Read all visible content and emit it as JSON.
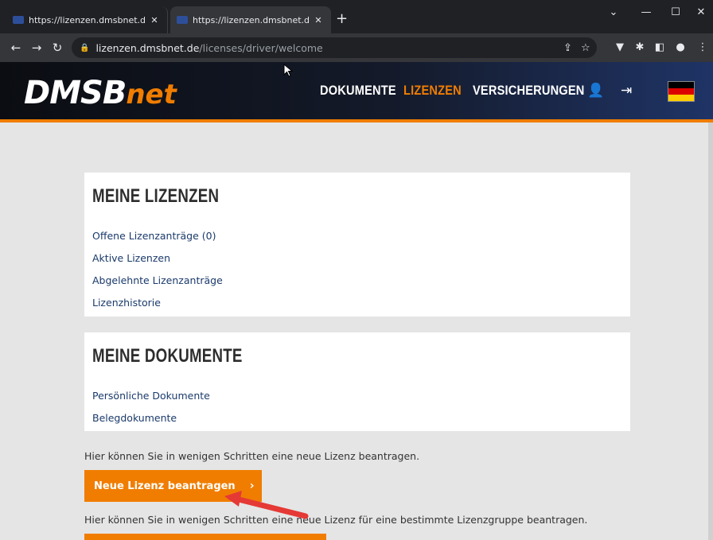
{
  "browser": {
    "tabs": [
      {
        "title": "https://lizenzen.dmsbnet.de/licen",
        "active": false
      },
      {
        "title": "https://lizenzen.dmsbnet.de/licen",
        "active": true
      }
    ],
    "new_tab": "+",
    "address": {
      "host": "lizenzen.dmsbnet.de",
      "path": "/licenses/driver/welcome"
    }
  },
  "site": {
    "logo_main": "DMSB",
    "logo_suffix": "net",
    "nav": [
      {
        "label": "DOKUMENTE",
        "active": false
      },
      {
        "label": "LIZENZEN",
        "active": true
      },
      {
        "label": "VERSICHERUNGEN",
        "active": false
      }
    ],
    "flag_colors": [
      "#000000",
      "#dd0000",
      "#ffce00"
    ],
    "accent": "#f07d00"
  },
  "licenses_card": {
    "title": "MEINE LIZENZEN",
    "links": [
      "Offene Lizenzanträge (0)",
      "Aktive Lizenzen",
      "Abgelehnte Lizenzanträge",
      "Lizenzhistorie"
    ]
  },
  "documents_card": {
    "title": "MEINE DOKUMENTE",
    "links": [
      "Persönliche Dokumente",
      "Belegdokumente"
    ]
  },
  "new_license": {
    "info": "Hier können Sie in wenigen Schritten eine neue Lizenz beantragen.",
    "button": "Neue Lizenz beantragen",
    "chevron": "›"
  },
  "group_license": {
    "info": "Hier können Sie in wenigen Schritten eine neue Lizenz für eine bestimmte Lizenzgruppe beantragen."
  }
}
